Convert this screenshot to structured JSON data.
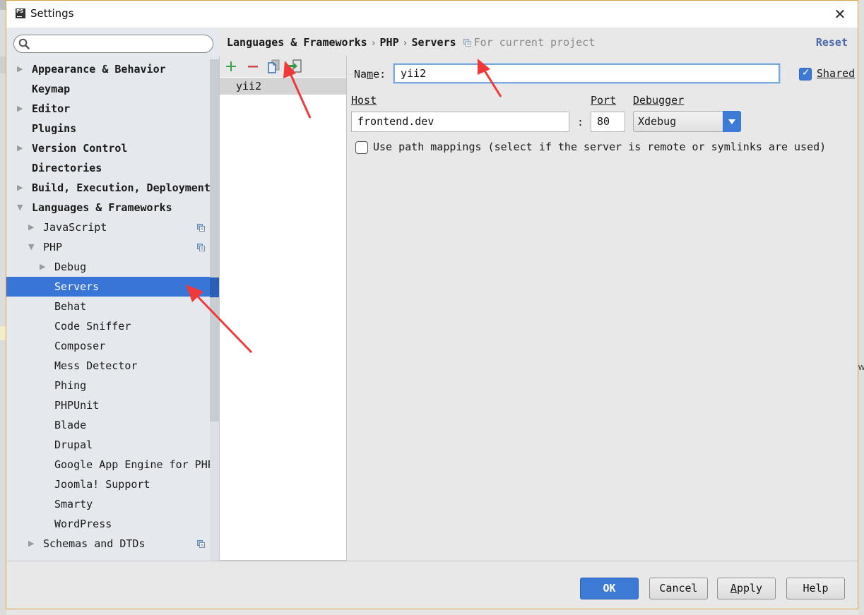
{
  "window": {
    "title": "Settings",
    "app_icon_label": "PS",
    "close_glyph": "✕"
  },
  "background": {
    "right_edge_text": "w"
  },
  "sidebar": {
    "search": {
      "value": "",
      "placeholder": ""
    },
    "items": [
      {
        "label": "Appearance & Behavior",
        "level": 0,
        "expandable": true,
        "expanded": false,
        "bold": true
      },
      {
        "label": "Keymap",
        "level": 0,
        "expandable": false,
        "bold": true
      },
      {
        "label": "Editor",
        "level": 0,
        "expandable": true,
        "expanded": false,
        "bold": true
      },
      {
        "label": "Plugins",
        "level": 0,
        "expandable": false,
        "bold": true
      },
      {
        "label": "Version Control",
        "level": 0,
        "expandable": true,
        "expanded": false,
        "bold": true
      },
      {
        "label": "Directories",
        "level": 0,
        "expandable": false,
        "bold": true
      },
      {
        "label": "Build, Execution, Deployment",
        "level": 0,
        "expandable": true,
        "expanded": false,
        "bold": true
      },
      {
        "label": "Languages & Frameworks",
        "level": 0,
        "expandable": true,
        "expanded": true,
        "bold": true
      },
      {
        "label": "JavaScript",
        "level": 1,
        "expandable": true,
        "expanded": false,
        "project_scope": true
      },
      {
        "label": "PHP",
        "level": 1,
        "expandable": true,
        "expanded": true,
        "project_scope": true
      },
      {
        "label": "Debug",
        "level": 2,
        "expandable": true,
        "expanded": false
      },
      {
        "label": "Servers",
        "level": 2,
        "expandable": false,
        "selected": true
      },
      {
        "label": "Behat",
        "level": 2,
        "expandable": false
      },
      {
        "label": "Code Sniffer",
        "level": 2,
        "expandable": false
      },
      {
        "label": "Composer",
        "level": 2,
        "expandable": false
      },
      {
        "label": "Mess Detector",
        "level": 2,
        "expandable": false
      },
      {
        "label": "Phing",
        "level": 2,
        "expandable": false
      },
      {
        "label": "PHPUnit",
        "level": 2,
        "expandable": false
      },
      {
        "label": "Blade",
        "level": 2,
        "expandable": false
      },
      {
        "label": "Drupal",
        "level": 2,
        "expandable": false
      },
      {
        "label": "Google App Engine for PHP",
        "level": 2,
        "expandable": false
      },
      {
        "label": "Joomla! Support",
        "level": 2,
        "expandable": false
      },
      {
        "label": "Smarty",
        "level": 2,
        "expandable": false
      },
      {
        "label": "WordPress",
        "level": 2,
        "expandable": false
      },
      {
        "label": "Schemas and DTDs",
        "level": 1,
        "expandable": true,
        "expanded": false,
        "project_scope": true
      }
    ]
  },
  "breadcrumb": {
    "parts": [
      "Languages & Frameworks",
      "PHP",
      "Servers"
    ],
    "separator": "›",
    "scope_label": "For current project"
  },
  "reset_label": "Reset",
  "server_list": {
    "toolbar": [
      "add",
      "remove",
      "copy",
      "import"
    ],
    "items": [
      "yii2"
    ],
    "selected": "yii2"
  },
  "form": {
    "name_label": "Name:",
    "name_mnemonic": "m",
    "name_value": "yii2",
    "shared_label": "Shared",
    "shared_checked": true,
    "host_label": "Host",
    "host_value": "frontend.dev",
    "host_port_separator": ":",
    "port_label": "Port",
    "port_value": "80",
    "debugger_label": "Debugger",
    "debugger_value": "Xdebug",
    "path_mappings_label": "Use path mappings (select if the server is remote or symlinks are used)",
    "path_mappings_checked": false
  },
  "buttons": {
    "ok": "OK",
    "cancel": "Cancel",
    "apply": "Apply",
    "help": "Help"
  },
  "colors": {
    "accent": "#3875d7",
    "button_primary": "#3d7ad6",
    "link": "#4a68a8",
    "dialog_border": "#d9a54a",
    "annotation_arrow": "#f03a3a"
  }
}
